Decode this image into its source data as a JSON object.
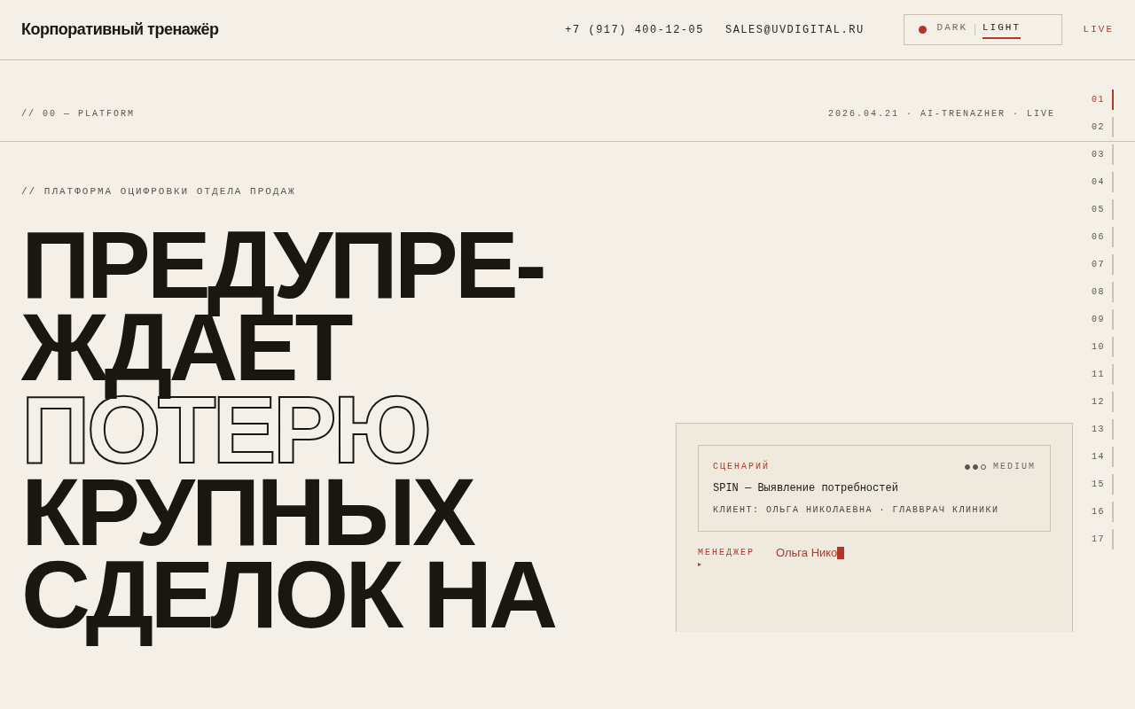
{
  "header": {
    "brand": "Корпоративный тренажёр",
    "phone": "+7 (917) 400-12-05",
    "email": "SALES@UVDIGITAL.RU",
    "theme_options": [
      {
        "label": "DARK",
        "selected": false
      },
      {
        "label": "LIGHT",
        "selected": true
      }
    ],
    "live": "LIVE"
  },
  "section_bar": {
    "label": "// 00 — PLATFORM",
    "meta": "2026.04.21 · AI-TRENAZHER · LIVE"
  },
  "rail": [
    {
      "label": "01",
      "selected": true
    },
    {
      "label": "02",
      "selected": false
    },
    {
      "label": "03",
      "selected": false
    },
    {
      "label": "04",
      "selected": false
    },
    {
      "label": "05",
      "selected": false
    },
    {
      "label": "06",
      "selected": false
    },
    {
      "label": "07",
      "selected": false
    },
    {
      "label": "08",
      "selected": false
    },
    {
      "label": "09",
      "selected": false
    },
    {
      "label": "10",
      "selected": false
    },
    {
      "label": "11",
      "selected": false
    },
    {
      "label": "12",
      "selected": false
    },
    {
      "label": "13",
      "selected": false
    },
    {
      "label": "14",
      "selected": false
    },
    {
      "label": "15",
      "selected": false
    },
    {
      "label": "16",
      "selected": false
    },
    {
      "label": "17",
      "selected": false
    }
  ],
  "hero": {
    "eyebrow": "// ПЛАТФОРМА ОЦИФРОВКИ ОТДЕЛА ПРОДАЖ",
    "lines": [
      {
        "text": "ПРЕДУПРЕ-",
        "outline": false
      },
      {
        "text": "ЖДАЕТ",
        "outline": false
      },
      {
        "text": "ПОТЕРЮ",
        "outline": true
      },
      {
        "text": "КРУПНЫХ",
        "outline": false
      },
      {
        "text": "СДЕЛОК НА",
        "outline": false
      }
    ]
  },
  "demo": {
    "scenario_label": "СЦЕНАРИЙ",
    "stars": 2,
    "difficulty": "MEDIUM",
    "scenario": "SPIN — Выявление потребностей",
    "client": "КЛИЕНТ: ОЛЬГА НИКОЛАЕВНА · ГЛАВВРАЧ КЛИНИКИ",
    "speaker": "МЕНЕДЖЕР",
    "speaker_marker": "▸",
    "message": "Ольга Нико"
  }
}
